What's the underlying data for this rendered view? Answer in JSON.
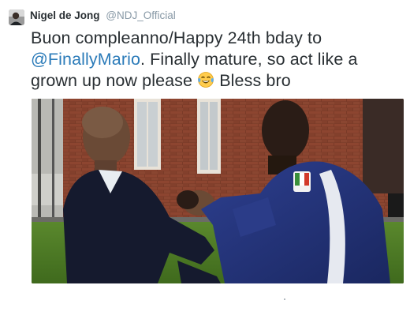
{
  "tweet": {
    "author_name": "Nigel de Jong",
    "author_handle": "@NDJ_Official",
    "text_part1": "Buon compleanno/Happy 24th bday to ",
    "mention": "@FinallyMario",
    "text_part2": ". Finally mature, so act like a grown up now please ",
    "emoji_name": "face-with-tears-of-joy",
    "text_part3": " Bless bro"
  },
  "colors": {
    "text": "#292f33",
    "secondary": "#8899a6",
    "link": "#2b7bb9"
  }
}
